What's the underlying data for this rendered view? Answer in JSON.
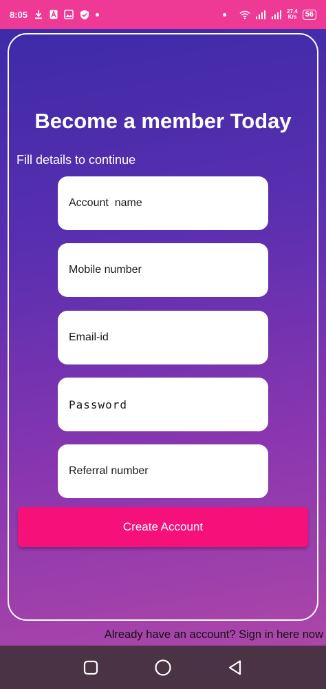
{
  "status_bar": {
    "time": "8:05",
    "net_speed_value": "27.4",
    "net_speed_unit": "K/s",
    "battery": "56"
  },
  "signup": {
    "title": "Become a member Today",
    "subtitle": "Fill details to continue",
    "fields": [
      {
        "placeholder": "Account  name"
      },
      {
        "placeholder": "Mobile number"
      },
      {
        "placeholder": "Email-id"
      },
      {
        "placeholder": "Password"
      },
      {
        "placeholder": "Referral number"
      }
    ],
    "create_button": "Create Account",
    "signin_link": "Already have an account? Sign in here now"
  },
  "colors": {
    "status_bar": "#ee3a95",
    "button": "#f5107a",
    "nav_bar": "#4a3344"
  },
  "icons": {
    "status": [
      "download-icon",
      "a-icon",
      "image-icon",
      "shield-icon",
      "wifi-icon",
      "signal-icon",
      "battery-icon"
    ],
    "nav": [
      "recent-apps-icon",
      "home-icon",
      "back-icon"
    ]
  }
}
